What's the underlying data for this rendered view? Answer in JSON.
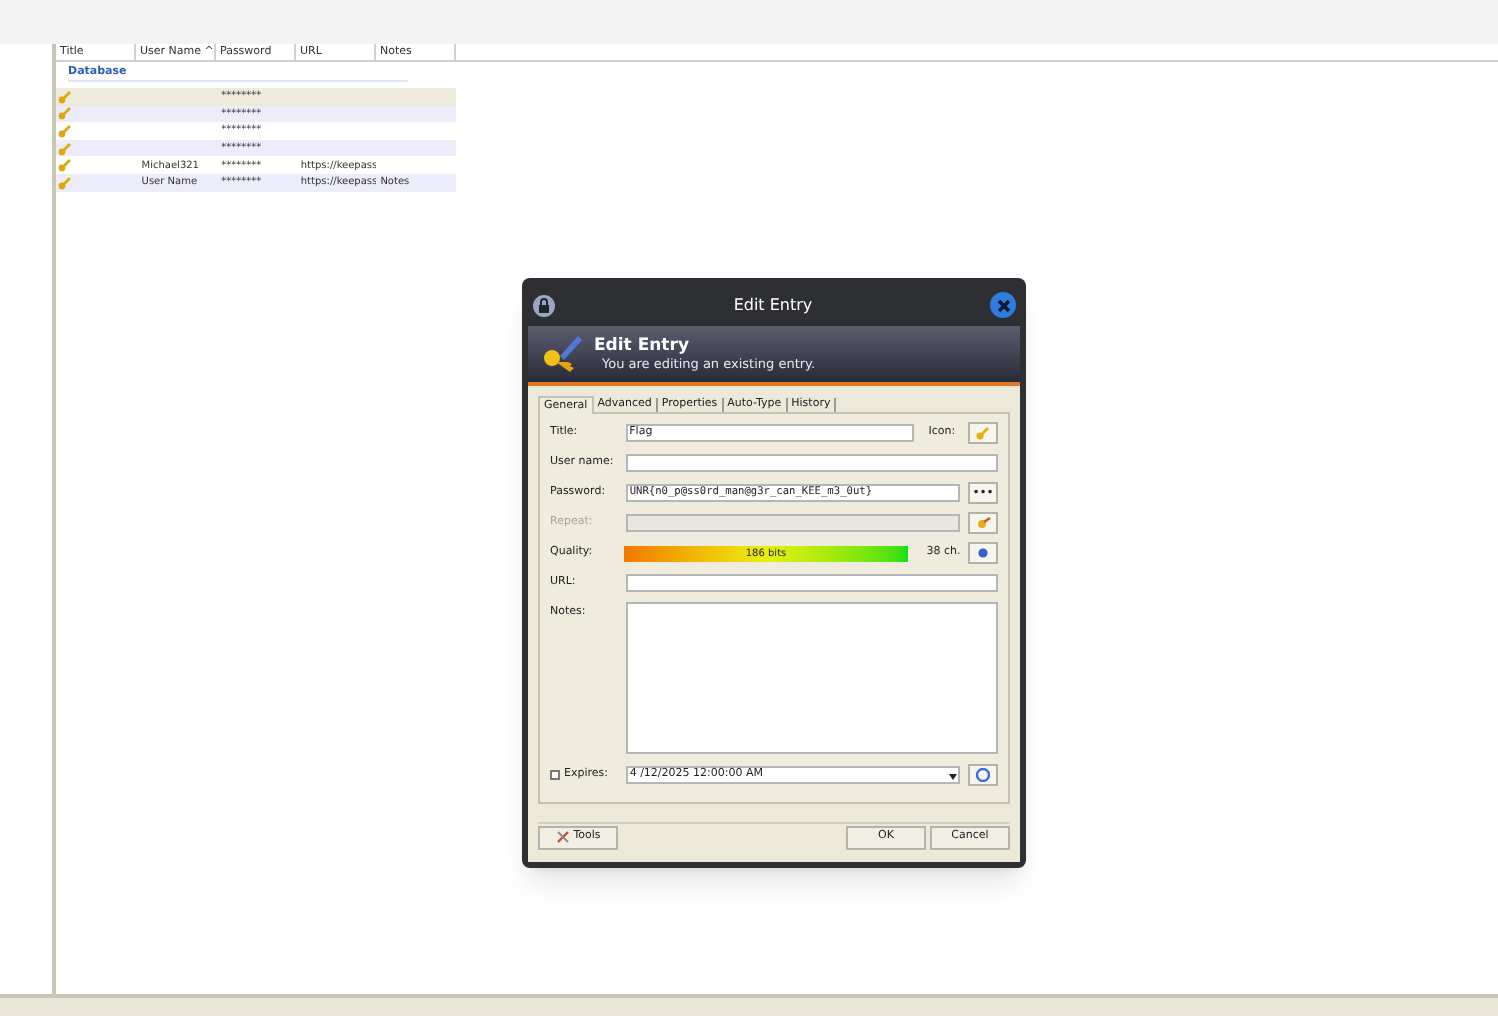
{
  "columns": [
    "Title",
    "User Name ^",
    "Password",
    "URL",
    "Notes"
  ],
  "group": "Database",
  "rows": [
    {
      "username": "",
      "password": "********",
      "url": "",
      "notes": "",
      "selected": true
    },
    {
      "username": "",
      "password": "********",
      "url": "",
      "notes": "",
      "selected": false
    },
    {
      "username": "",
      "password": "********",
      "url": "",
      "notes": "",
      "selected": false
    },
    {
      "username": "",
      "password": "********",
      "url": "",
      "notes": "",
      "selected": false
    },
    {
      "username": "Michael321",
      "password": "********",
      "url": "https://keepass",
      "notes": "",
      "selected": false
    },
    {
      "username": "User Name",
      "password": "********",
      "url": "https://keepass",
      "notes": "Notes",
      "selected": false
    }
  ],
  "dialog": {
    "title": "Edit Entry",
    "banner_title": "Edit Entry",
    "banner_subtitle": "You are editing an existing entry.",
    "tabs": [
      {
        "label": "General",
        "selected": true
      },
      {
        "label": "Advanced",
        "selected": false
      },
      {
        "label": "Properties",
        "selected": false
      },
      {
        "label": "Auto-Type",
        "selected": false
      },
      {
        "label": "History",
        "selected": false
      }
    ],
    "title_label": "Title:",
    "title_value": "Flag",
    "icon_label": "Icon:",
    "username_label": "User name:",
    "password_label": "Password:",
    "password_value": "UNR{n0_p@ss0rd_man@g3r_can_KEE_m3_0ut}",
    "password_toggle": "•••",
    "repeat_label": "Repeat:",
    "repeat_disabled": true,
    "quality_label": "Quality:",
    "quality": {
      "level": 1,
      "reading": "186 bits"
    },
    "chars": "38 ch.",
    "url_label": "URL:",
    "notes_label": "Notes:",
    "expires": {
      "label": "Expires:",
      "checked": false,
      "value": "4 /12/2025 12:00:00 AM"
    },
    "buttons": {
      "tools": "Tools",
      "ok": "OK",
      "cancel": "Cancel"
    }
  }
}
